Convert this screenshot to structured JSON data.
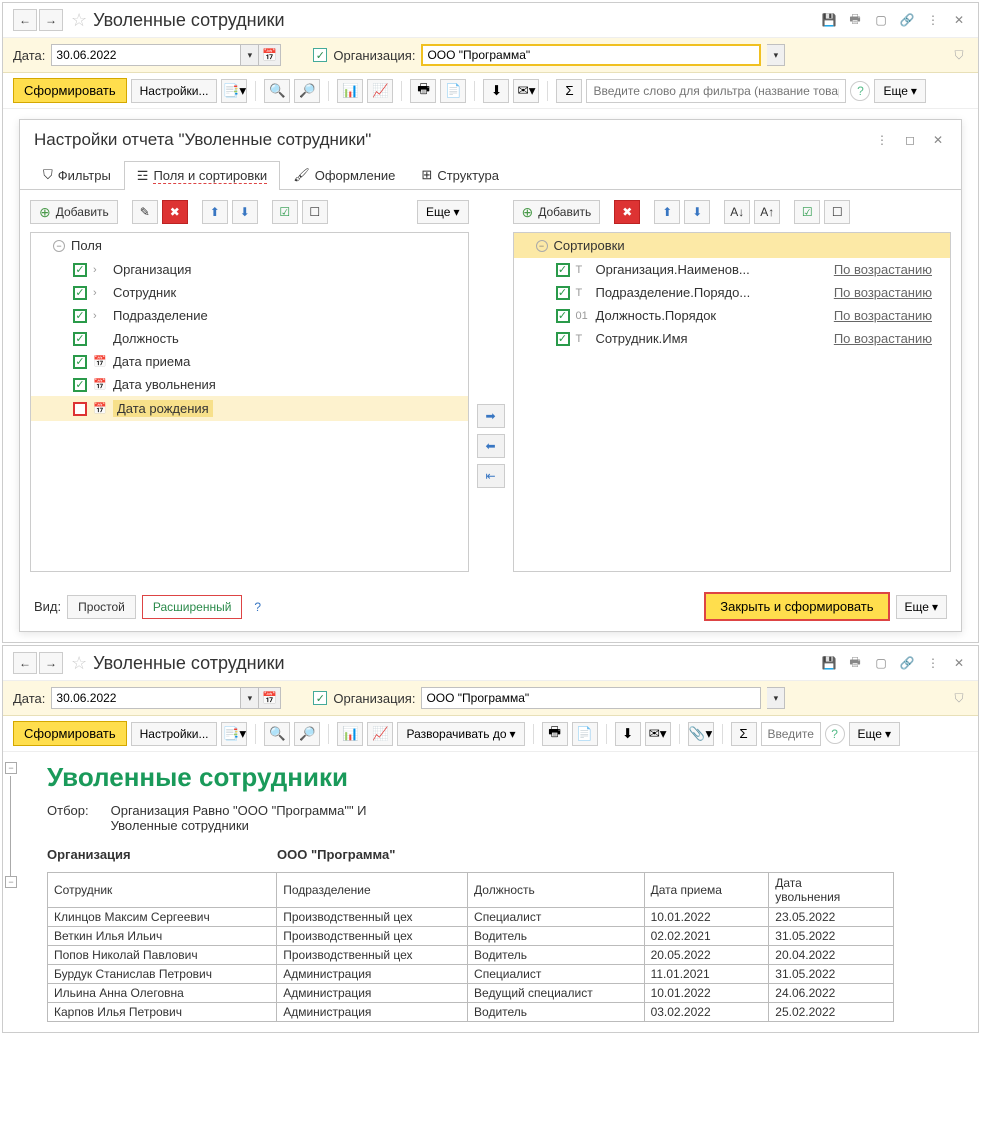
{
  "window1": {
    "title": "Уволенные сотрудники",
    "date_label": "Дата:",
    "date_value": "30.06.2022",
    "org_label": "Организация:",
    "org_value": "ООО \"Программа\"",
    "form_btn": "Сформировать",
    "settings_btn": "Настройки...",
    "search_ph": "Введите слово для фильтра (название товар...",
    "more_btn": "Еще"
  },
  "dialog": {
    "title": "Настройки отчета \"Уволенные сотрудники\"",
    "tabs": {
      "filters": "Фильтры",
      "fields": "Поля и сортировки",
      "format": "Оформление",
      "structure": "Структура"
    },
    "add_btn": "Добавить",
    "more_btn": "Еще",
    "fields_header": "Поля",
    "fields": {
      "org": "Организация",
      "emp": "Сотрудник",
      "dept": "Подразделение",
      "pos": "Должность",
      "hire": "Дата приема",
      "fire": "Дата увольнения",
      "birth": "Дата рождения"
    },
    "sorts_header": "Сортировки",
    "sorts": {
      "s1": "Организация.Наименов...",
      "s2": "Подразделение.Порядо...",
      "s3": "Должность.Порядок",
      "s4": "Сотрудник.Имя"
    },
    "asc": "По возрастанию",
    "view_label": "Вид:",
    "view_simple": "Простой",
    "view_ext": "Расширенный",
    "close_form": "Закрыть и сформировать"
  },
  "window2": {
    "title": "Уволенные сотрудники",
    "date_label": "Дата:",
    "date_value": "30.06.2022",
    "org_label": "Организация:",
    "org_value": "ООО \"Программа\"",
    "form_btn": "Сформировать",
    "settings_btn": "Настройки...",
    "expand_btn": "Разворачивать до",
    "search_ph": "Введите сл...",
    "more_btn": "Еще"
  },
  "report": {
    "title": "Уволенные сотрудники",
    "filter_label": "Отбор:",
    "filter_line1": "Организация Равно \"ООО \"Программа\"\" И",
    "filter_line2": "Уволенные сотрудники",
    "org_label": "Организация",
    "org_val": "ООО \"Программа\"",
    "cols": {
      "emp": "Сотрудник",
      "dept": "Подразделение",
      "pos": "Должность",
      "hire": "Дата приема",
      "fire": "Дата увольнения"
    },
    "rows": [
      {
        "emp": "Клинцов Максим Сергеевич",
        "dept": "Производственный цех",
        "pos": "Специалист",
        "hire": "10.01.2022",
        "fire": "23.05.2022"
      },
      {
        "emp": "Веткин Илья Ильич",
        "dept": "Производственный цех",
        "pos": "Водитель",
        "hire": "02.02.2021",
        "fire": "31.05.2022"
      },
      {
        "emp": "Попов Николай Павлович",
        "dept": "Производственный цех",
        "pos": "Водитель",
        "hire": "20.05.2022",
        "fire": "20.04.2022"
      },
      {
        "emp": "Бурдук Станислав Петрович",
        "dept": "Администрация",
        "pos": "Специалист",
        "hire": "11.01.2021",
        "fire": "31.05.2022"
      },
      {
        "emp": "Ильина Анна Олеговна",
        "dept": "Администрация",
        "pos": "Ведущий специалист",
        "hire": "10.01.2022",
        "fire": "24.06.2022"
      },
      {
        "emp": "Карпов Илья Петрович",
        "dept": "Администрация",
        "pos": "Водитель",
        "hire": "03.02.2022",
        "fire": "25.02.2022"
      }
    ]
  }
}
